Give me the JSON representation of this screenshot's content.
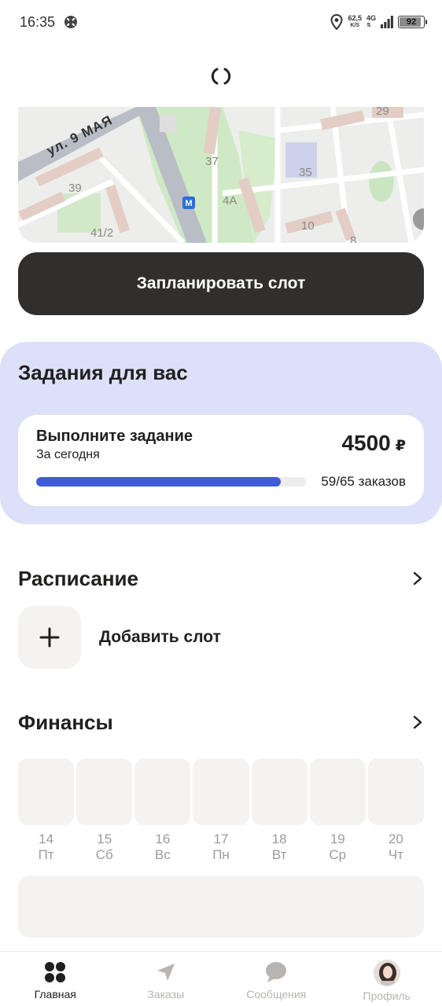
{
  "status_bar": {
    "time": "16:35",
    "net_speed_value": "62,5",
    "net_speed_unit": "K/S",
    "network_type": "4G",
    "battery": "92",
    "battery_level": 0.92
  },
  "map": {
    "street_label": "ул. 9 МАЯ",
    "house_numbers": [
      "29",
      "37",
      "35",
      "39",
      "4А",
      "41/2",
      "10",
      "8"
    ]
  },
  "plan_button": {
    "label": "Запланировать слот"
  },
  "tasks": {
    "title": "Задания для вас",
    "card": {
      "title": "Выполните задание",
      "subtitle": "За сегодня",
      "reward": "4500",
      "currency": "₽",
      "progress_label": "59/65 заказов",
      "progress_done": 59,
      "progress_total": 65
    }
  },
  "schedule": {
    "title": "Расписание",
    "add_slot_label": "Добавить слот"
  },
  "finance": {
    "title": "Финансы",
    "days": [
      {
        "num": "14",
        "name": "Пт"
      },
      {
        "num": "15",
        "name": "Сб"
      },
      {
        "num": "16",
        "name": "Вс"
      },
      {
        "num": "17",
        "name": "Пн"
      },
      {
        "num": "18",
        "name": "Вт"
      },
      {
        "num": "19",
        "name": "Ср"
      },
      {
        "num": "20",
        "name": "Чт"
      }
    ]
  },
  "tab_bar": {
    "tabs": [
      {
        "label": "Главная",
        "icon": "grid-icon",
        "active": true
      },
      {
        "label": "Заказы",
        "icon": "navigation-arrow-icon",
        "active": false
      },
      {
        "label": "Сообщения",
        "icon": "chat-bubble-icon",
        "active": false
      },
      {
        "label": "Профиль",
        "icon": "avatar",
        "active": false
      }
    ]
  },
  "colors": {
    "accent": "#3f5bd8",
    "tasks_bg": "#dde0f9",
    "button_dark": "#302f2d"
  }
}
